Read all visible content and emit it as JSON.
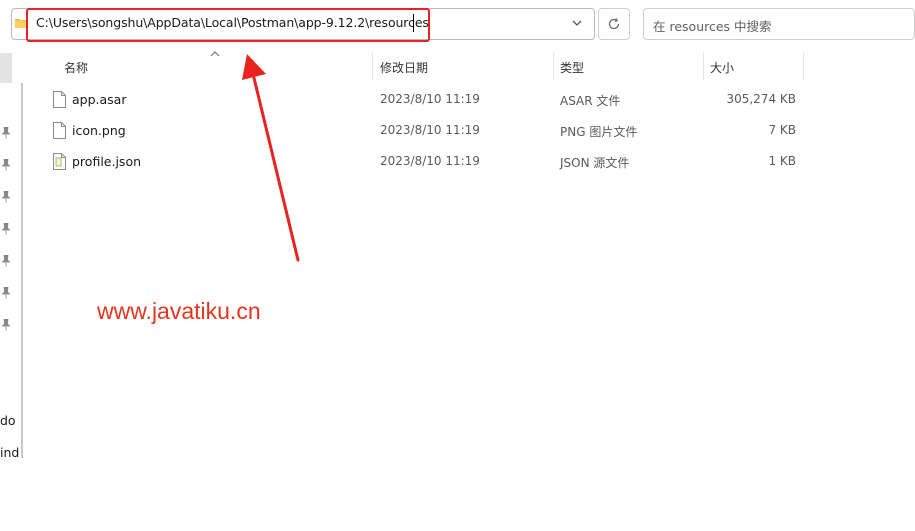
{
  "address": {
    "path": "C:\\Users\\songshu\\AppData\\Local\\Postman\\app-9.12.2\\resources",
    "search_placeholder": "在 resources 中搜索"
  },
  "nav": {
    "partial_labels": [
      "do",
      "ind"
    ]
  },
  "columns": {
    "name": "名称",
    "modified": "修改日期",
    "type": "类型",
    "size": "大小"
  },
  "files": [
    {
      "name": "app.asar",
      "modified": "2023/8/10 11:19",
      "type": "ASAR 文件",
      "size": "305,274 KB",
      "icon": "file-icon"
    },
    {
      "name": "icon.png",
      "modified": "2023/8/10 11:19",
      "type": "PNG 图片文件",
      "size": "7 KB",
      "icon": "file-icon"
    },
    {
      "name": "profile.json",
      "modified": "2023/8/10 11:19",
      "type": "JSON 源文件",
      "size": "1 KB",
      "icon": "json-file-icon"
    }
  ],
  "watermark": "www.javatiku.cn",
  "colors": {
    "annotation_red": "#e8231f",
    "folder_yellow": "#f3c14b"
  }
}
